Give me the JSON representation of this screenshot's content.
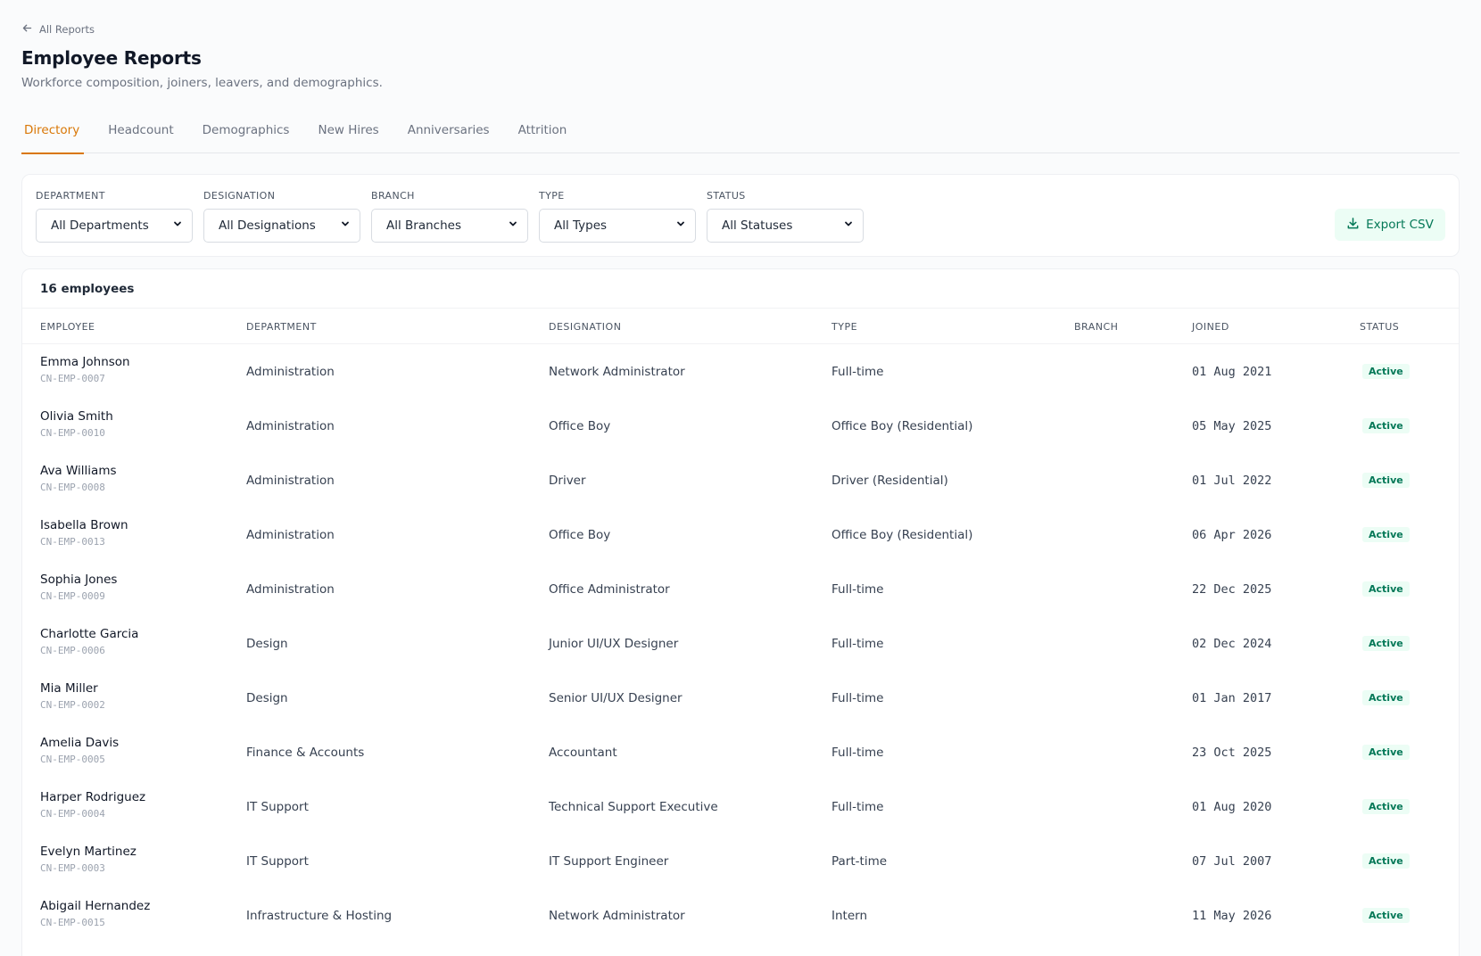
{
  "back_link": {
    "label": "All Reports",
    "icon": "arrow-left-icon"
  },
  "header": {
    "title": "Employee Reports",
    "subtitle": "Workforce composition, joiners, leavers, and demographics."
  },
  "tabs": [
    {
      "label": "Directory",
      "active": true
    },
    {
      "label": "Headcount",
      "active": false
    },
    {
      "label": "Demographics",
      "active": false
    },
    {
      "label": "New Hires",
      "active": false
    },
    {
      "label": "Anniversaries",
      "active": false
    },
    {
      "label": "Attrition",
      "active": false
    }
  ],
  "filters": [
    {
      "label": "DEPARTMENT",
      "value": "All Departments"
    },
    {
      "label": "DESIGNATION",
      "value": "All Designations"
    },
    {
      "label": "BRANCH",
      "value": "All Branches"
    },
    {
      "label": "TYPE",
      "value": "All Types"
    },
    {
      "label": "STATUS",
      "value": "All Statuses"
    }
  ],
  "export": {
    "label": "Export CSV",
    "icon": "download-icon"
  },
  "table": {
    "count_label": "16 employees",
    "columns": [
      "EMPLOYEE",
      "DEPARTMENT",
      "DESIGNATION",
      "TYPE",
      "BRANCH",
      "JOINED",
      "STATUS"
    ],
    "rows": [
      {
        "name": "Emma Johnson",
        "id": "CN-EMP-0007",
        "department": "Administration",
        "designation": "Network Administrator",
        "type": "Full-time",
        "branch": "",
        "joined": "01 Aug 2021",
        "status": "Active"
      },
      {
        "name": "Olivia Smith",
        "id": "CN-EMP-0010",
        "department": "Administration",
        "designation": "Office Boy",
        "type": "Office Boy (Residential)",
        "branch": "",
        "joined": "05 May 2025",
        "status": "Active"
      },
      {
        "name": "Ava Williams",
        "id": "CN-EMP-0008",
        "department": "Administration",
        "designation": "Driver",
        "type": "Driver (Residential)",
        "branch": "",
        "joined": "01 Jul 2022",
        "status": "Active"
      },
      {
        "name": "Isabella Brown",
        "id": "CN-EMP-0013",
        "department": "Administration",
        "designation": "Office Boy",
        "type": "Office Boy (Residential)",
        "branch": "",
        "joined": "06 Apr 2026",
        "status": "Active"
      },
      {
        "name": "Sophia Jones",
        "id": "CN-EMP-0009",
        "department": "Administration",
        "designation": "Office Administrator",
        "type": "Full-time",
        "branch": "",
        "joined": "22 Dec 2025",
        "status": "Active"
      },
      {
        "name": "Charlotte Garcia",
        "id": "CN-EMP-0006",
        "department": "Design",
        "designation": "Junior UI/UX Designer",
        "type": "Full-time",
        "branch": "",
        "joined": "02 Dec 2024",
        "status": "Active"
      },
      {
        "name": "Mia Miller",
        "id": "CN-EMP-0002",
        "department": "Design",
        "designation": "Senior UI/UX Designer",
        "type": "Full-time",
        "branch": "",
        "joined": "01 Jan 2017",
        "status": "Active"
      },
      {
        "name": "Amelia Davis",
        "id": "CN-EMP-0005",
        "department": "Finance & Accounts",
        "designation": "Accountant",
        "type": "Full-time",
        "branch": "",
        "joined": "23 Oct 2025",
        "status": "Active"
      },
      {
        "name": "Harper Rodriguez",
        "id": "CN-EMP-0004",
        "department": "IT Support",
        "designation": "Technical Support Executive",
        "type": "Full-time",
        "branch": "",
        "joined": "01 Aug 2020",
        "status": "Active"
      },
      {
        "name": "Evelyn Martinez",
        "id": "CN-EMP-0003",
        "department": "IT Support",
        "designation": "IT Support Engineer",
        "type": "Part-time",
        "branch": "",
        "joined": "07 Jul 2007",
        "status": "Active"
      },
      {
        "name": "Abigail Hernandez",
        "id": "CN-EMP-0015",
        "department": "Infrastructure & Hosting",
        "designation": "Network Administrator",
        "type": "Intern",
        "branch": "",
        "joined": "11 May 2026",
        "status": "Active"
      }
    ]
  },
  "colors": {
    "accent": "#d97706",
    "success_bg": "#ecfdf5",
    "success_text": "#047857"
  }
}
